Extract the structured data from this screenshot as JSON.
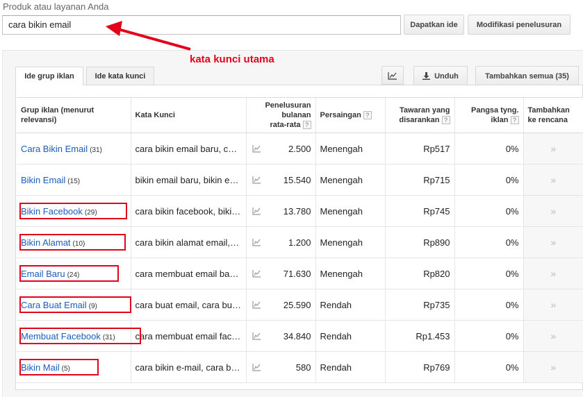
{
  "search": {
    "label": "Produk atau layanan Anda",
    "value": "cara bikin email",
    "get_ideas_label": "Dapatkan ide",
    "modify_label": "Modifikasi penelusuran"
  },
  "annotation": {
    "text": "kata kunci utama",
    "color": "#e3001b"
  },
  "tabs": {
    "ad_group_ideas": "Ide grup iklan",
    "keyword_ideas": "Ide kata kunci"
  },
  "toolbar": {
    "chart_icon": "chart-icon",
    "download_label": "Unduh",
    "add_all_label": "Tambahkan semua (35)"
  },
  "table": {
    "headers": {
      "group": "Grup iklan (menurut relevansi)",
      "keywords": "Kata Kunci",
      "searches_l1": "Penelusuran",
      "searches_l2": "bulanan",
      "searches_l3": "rata-rata",
      "competition": "Persaingan",
      "bid_l1": "Tawaran yang",
      "bid_l2": "disarankan",
      "share_l1": "Pangsa tyng.",
      "share_l2": "iklan",
      "add_l1": "Tambahkan",
      "add_l2": "ke rencana"
    },
    "help_mark": "?",
    "add_glyph": "»",
    "rows": [
      {
        "group": "Cara Bikin Email",
        "count": "(31)",
        "keywords": "cara bikin email baru, cara bikin email gmail",
        "searches": "2.500",
        "competition": "Menengah",
        "bid": "Rp517",
        "share": "0%"
      },
      {
        "group": "Bikin Email",
        "count": "(15)",
        "keywords": "bikin email baru, bikin email gratis",
        "searches": "15.540",
        "competition": "Menengah",
        "bid": "Rp715",
        "share": "0%"
      },
      {
        "group": "Bikin Facebook",
        "count": "(29)",
        "keywords": "cara bikin facebook, bikin facebook baru",
        "searches": "13.780",
        "competition": "Menengah",
        "bid": "Rp745",
        "share": "0%"
      },
      {
        "group": "Bikin Alamat",
        "count": "(10)",
        "keywords": "cara bikin alamat email, bikin alamat email",
        "searches": "1.200",
        "competition": "Menengah",
        "bid": "Rp890",
        "share": "0%"
      },
      {
        "group": "Email Baru",
        "count": "(24)",
        "keywords": "cara membuat email baru, email baru",
        "searches": "71.630",
        "competition": "Menengah",
        "bid": "Rp820",
        "share": "0%"
      },
      {
        "group": "Cara Buat Email",
        "count": "(9)",
        "keywords": "cara buat email, cara buat email baru",
        "searches": "25.590",
        "competition": "Rendah",
        "bid": "Rp735",
        "share": "0%"
      },
      {
        "group": "Membuat Facebook",
        "count": "(31)",
        "keywords": "cara membuat email facebook, membuat facebook",
        "searches": "34.840",
        "competition": "Rendah",
        "bid": "Rp1.453",
        "share": "0%"
      },
      {
        "group": "Bikin Mail",
        "count": "(5)",
        "keywords": "cara bikin e-mail, cara bikin mail",
        "searches": "580",
        "competition": "Rendah",
        "bid": "Rp769",
        "share": "0%"
      }
    ]
  }
}
